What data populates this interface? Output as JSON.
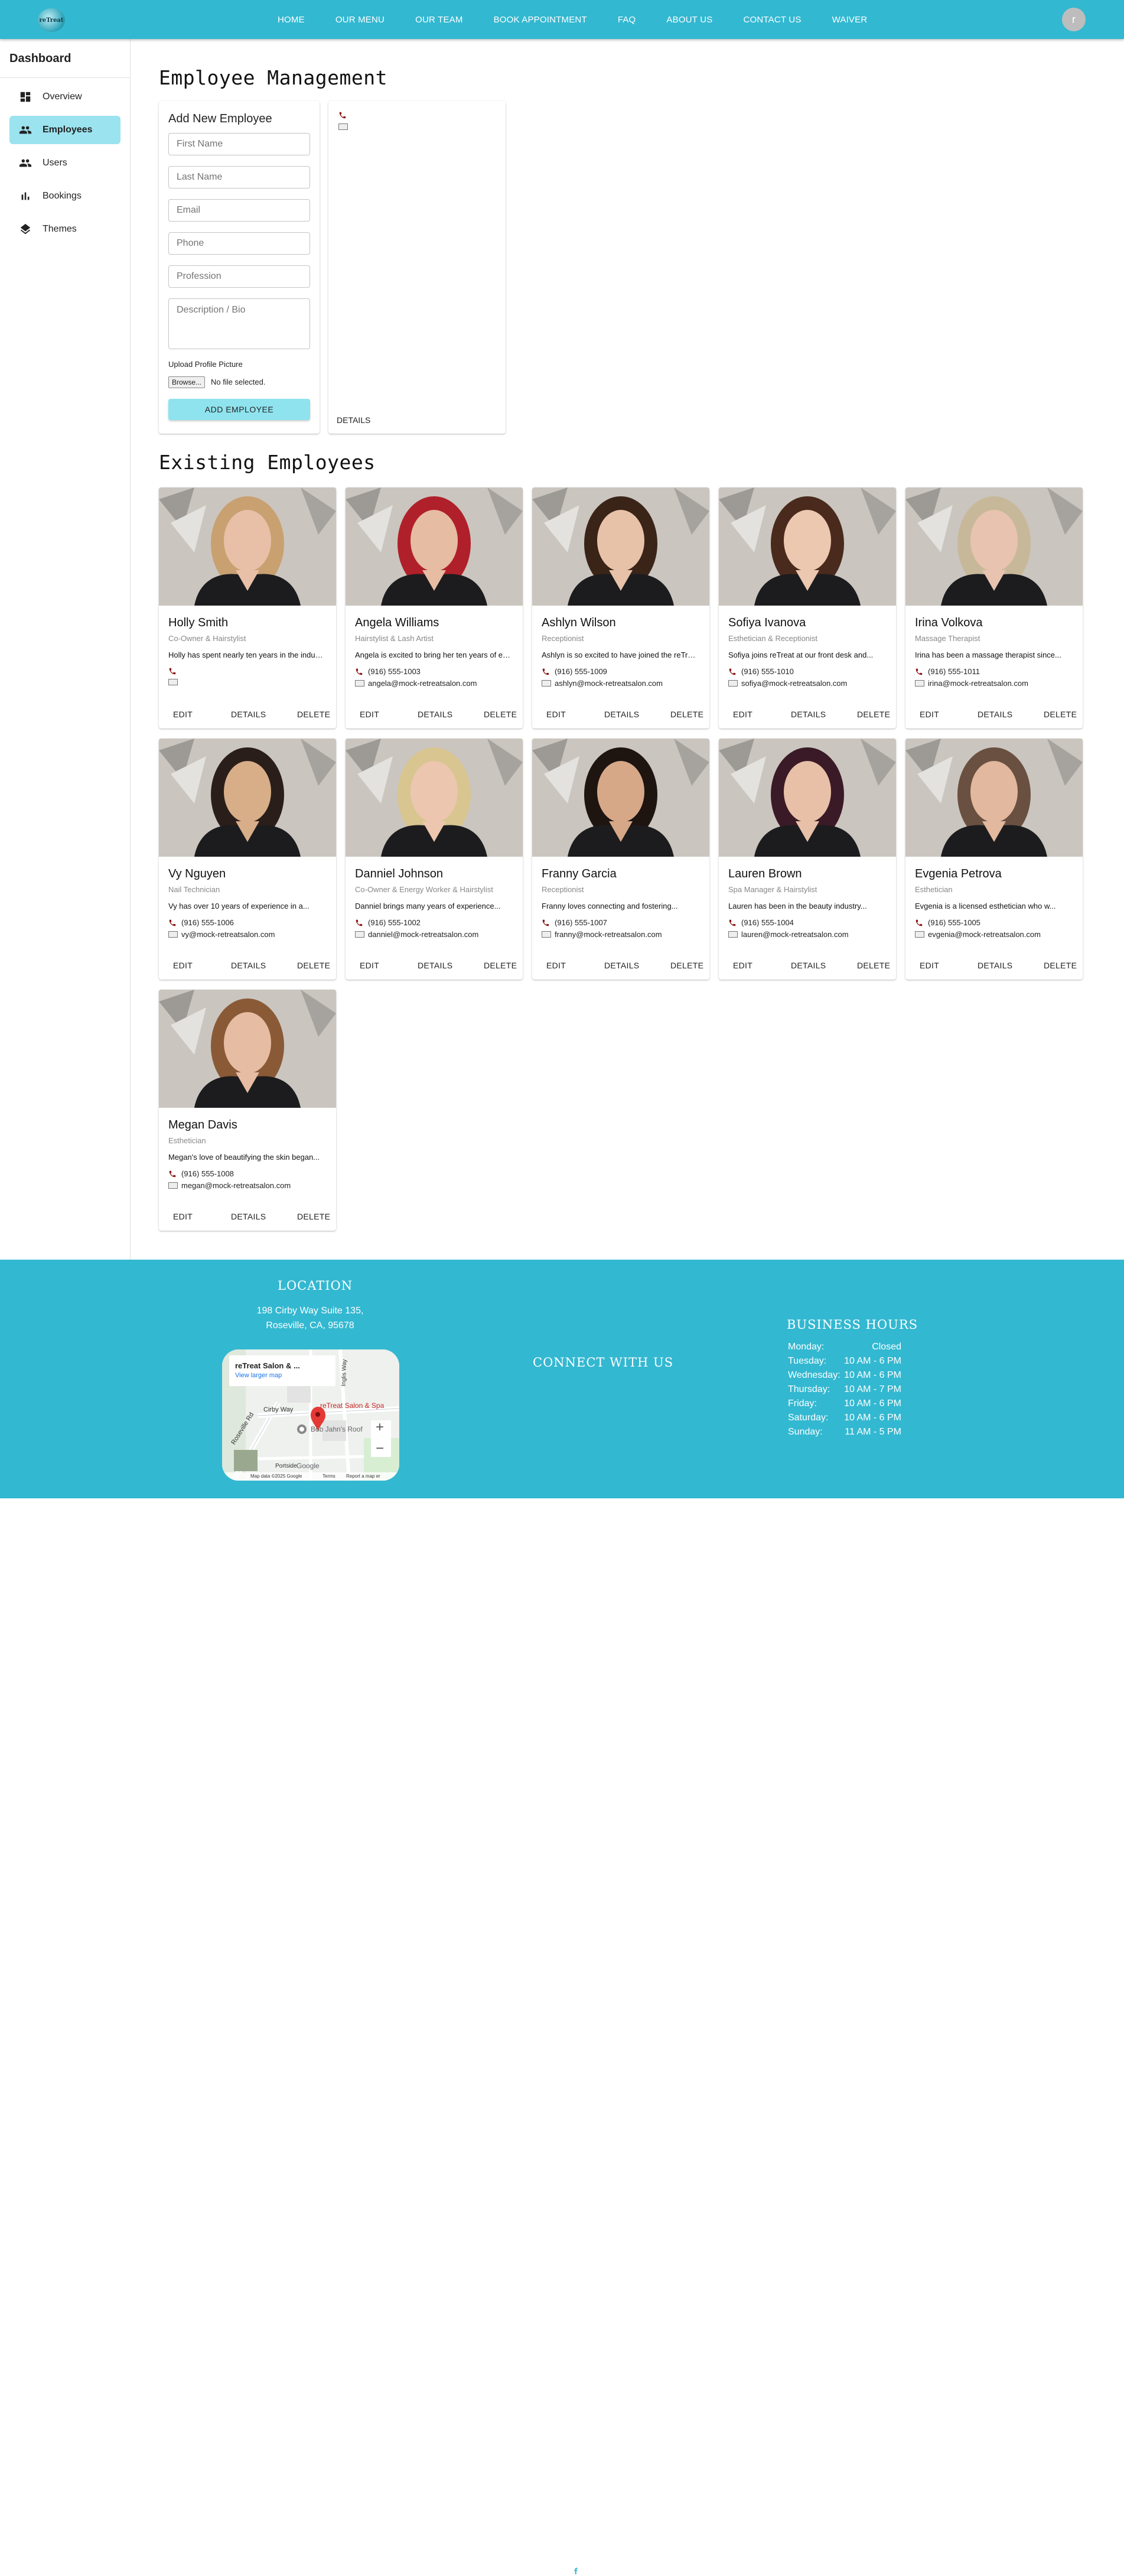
{
  "nav": {
    "logo_text": "reTreat",
    "links": [
      "HOME",
      "OUR MENU",
      "OUR TEAM",
      "BOOK APPOINTMENT",
      "FAQ",
      "ABOUT US",
      "CONTACT US",
      "WAIVER"
    ],
    "avatar_letter": "r"
  },
  "sidebar": {
    "title": "Dashboard",
    "items": [
      {
        "label": "Overview",
        "icon": "dashboard-icon",
        "active": false
      },
      {
        "label": "Employees",
        "icon": "people-icon",
        "active": true
      },
      {
        "label": "Users",
        "icon": "people-icon",
        "active": false
      },
      {
        "label": "Bookings",
        "icon": "bar-chart-icon",
        "active": false
      },
      {
        "label": "Themes",
        "icon": "layers-icon",
        "active": false
      }
    ]
  },
  "page": {
    "title": "Employee Management",
    "existing_title": "Existing Employees"
  },
  "form": {
    "title": "Add New Employee",
    "first_name_placeholder": "First Name",
    "last_name_placeholder": "Last Name",
    "email_placeholder": "Email",
    "phone_placeholder": "Phone",
    "profession_placeholder": "Profession",
    "bio_placeholder": "Description / Bio",
    "upload_label": "Upload Profile Picture",
    "browse_label": "Browse...",
    "no_file_label": "No file selected.",
    "submit_label": "ADD EMPLOYEE"
  },
  "preview": {
    "details_label": "DETAILS"
  },
  "actions": {
    "edit": "EDIT",
    "details": "DETAILS",
    "delete": "DELETE"
  },
  "employees": [
    {
      "name": "Holly Smith",
      "role": "Co-Owner & Hairstylist",
      "bio": "Holly has spent nearly ten years in the industry...",
      "phone": "",
      "email": ""
    },
    {
      "name": "Angela Williams",
      "role": "Hairstylist & Lash Artist",
      "bio": "Angela is excited to bring her ten years of experience...",
      "phone": "(916) 555-1003",
      "email": "angela@mock-retreatsalon.com"
    },
    {
      "name": "Ashlyn Wilson",
      "role": "Receptionist",
      "bio": "Ashlyn is so excited to have joined the reTreat team...",
      "phone": "(916) 555-1009",
      "email": "ashlyn@mock-retreatsalon.com"
    },
    {
      "name": "Sofiya Ivanova",
      "role": "Esthetician & Receptionist",
      "bio": "Sofiya joins reTreat at our front desk and...",
      "phone": "(916) 555-1010",
      "email": "sofiya@mock-retreatsalon.com"
    },
    {
      "name": "Irina Volkova",
      "role": "Massage Therapist",
      "bio": "Irina has been a massage therapist since...",
      "phone": "(916) 555-1011",
      "email": "irina@mock-retreatsalon.com"
    },
    {
      "name": "Vy Nguyen",
      "role": "Nail Technician",
      "bio": "Vy has over 10 years of experience in a...",
      "phone": "(916) 555-1006",
      "email": "vy@mock-retreatsalon.com"
    },
    {
      "name": "Danniel Johnson",
      "role": "Co-Owner & Energy Worker & Hairstylist",
      "bio": "Danniel brings many years of experience...",
      "phone": "(916) 555-1002",
      "email": "danniel@mock-retreatsalon.com"
    },
    {
      "name": "Franny Garcia",
      "role": "Receptionist",
      "bio": "Franny loves connecting and fostering...",
      "phone": "(916) 555-1007",
      "email": "franny@mock-retreatsalon.com"
    },
    {
      "name": "Lauren Brown",
      "role": "Spa Manager & Hairstylist",
      "bio": "Lauren has been in the beauty industry...",
      "phone": "(916) 555-1004",
      "email": "lauren@mock-retreatsalon.com"
    },
    {
      "name": "Evgenia Petrova",
      "role": "Esthetician",
      "bio": "Evgenia is a licensed esthetician who w...",
      "phone": "(916) 555-1005",
      "email": "evgenia@mock-retreatsalon.com"
    },
    {
      "name": "Megan Davis",
      "role": "Esthetician",
      "bio": "Megan's love of beautifying the skin began...",
      "phone": "(916) 555-1008",
      "email": "megan@mock-retreatsalon.com"
    }
  ],
  "footer": {
    "location_title": "LOCATION",
    "address_line1": "198 Cirby Way Suite 135,",
    "address_line2": "Roseville, CA, 95678",
    "connect_title": "CONNECT WITH US",
    "hours_title": "BUSINESS HOURS",
    "hours": [
      {
        "day": "Monday:",
        "time": "Closed"
      },
      {
        "day": "Tuesday:",
        "time": "10 AM - 6 PM"
      },
      {
        "day": "Wednesday:",
        "time": "10 AM - 6 PM"
      },
      {
        "day": "Thursday:",
        "time": "10 AM - 7 PM"
      },
      {
        "day": "Friday:",
        "time": "10 AM - 6 PM"
      },
      {
        "day": "Saturday:",
        "time": "10 AM - 6 PM"
      },
      {
        "day": "Sunday:",
        "time": "11 AM - 5 PM"
      }
    ],
    "map": {
      "place_name": "reTreat Salon & ...",
      "larger_map_link": "View larger map",
      "pin_label": "reTreat Salon & Spa",
      "street_cirby": "Cirby Way",
      "street_roseville": "Roseville Rd",
      "street_inglis": "Inglis Way",
      "poi_bob": "Bob Jahn's Roof",
      "street_portside": "Portside",
      "attribution": "Map data ©2025 Google",
      "terms": "Terms",
      "report": "Report a map er",
      "zoom_in": "+",
      "zoom_out": "−",
      "google": "Google"
    }
  },
  "colors": {
    "brand": "#33b8d1",
    "active_item": "#9be3ef",
    "add_button": "#8fe3ee"
  }
}
